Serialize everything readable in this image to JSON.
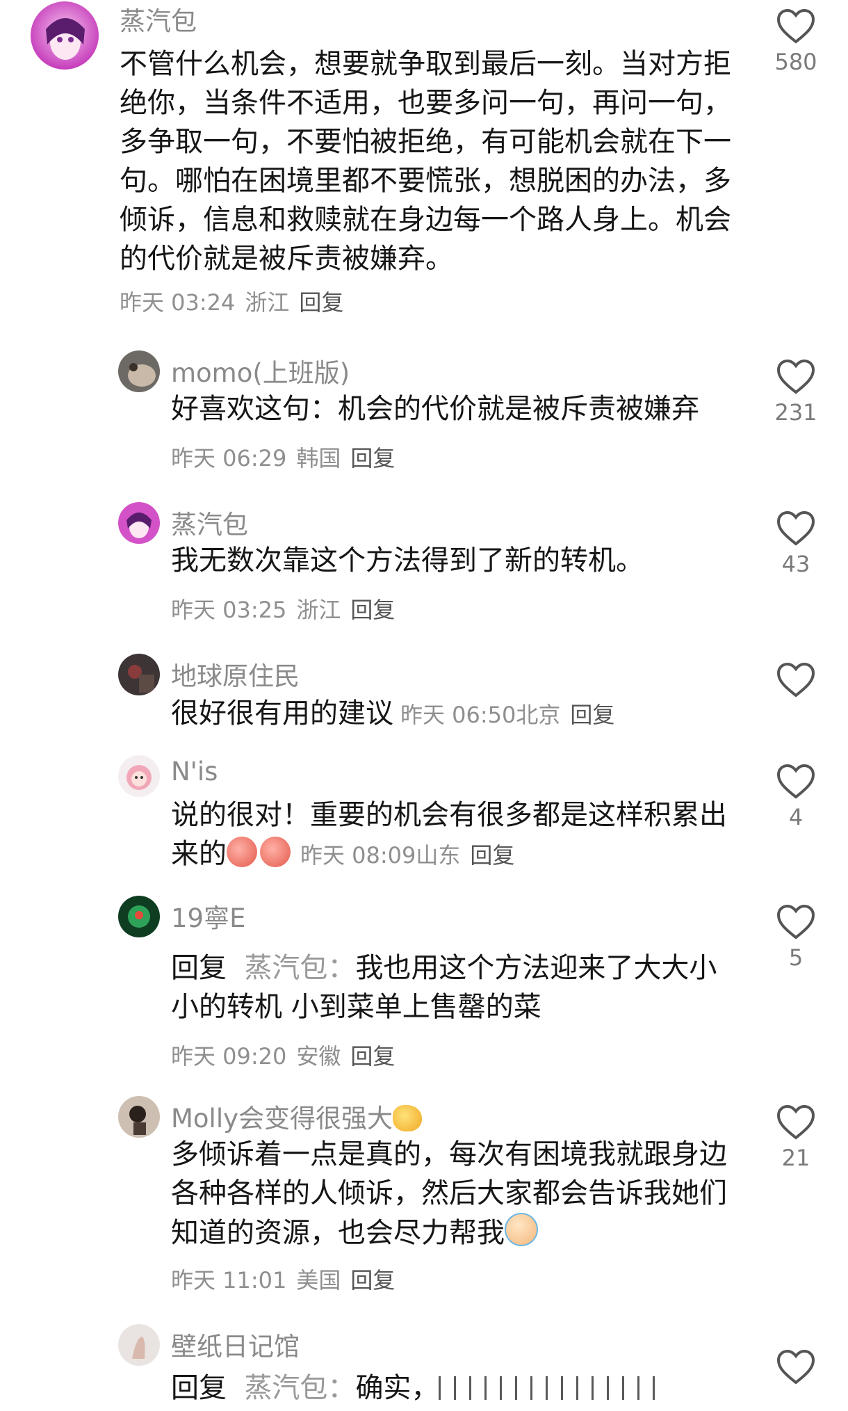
{
  "comments": [
    {
      "username": "蒸汽包",
      "text": "不管什么机会，想要就争取到最后一刻。当对方拒绝你，当条件不适用，也要多问一句，再问一句，多争取一句，不要怕被拒绝，有可能机会就在下一句。哪怕在困境里都不要慌张，想脱困的办法，多倾诉，信息和救赎就在身边每一个路人身上。机会的代价就是被斥责被嫌弃。",
      "time": "昨天 03:24",
      "location": "浙江",
      "reply_label": "回复",
      "likes": "580"
    }
  ],
  "replies": [
    {
      "username": "momo(上班版)",
      "text": "好喜欢这句：机会的代价就是被斥责被嫌弃",
      "time": "昨天 06:29",
      "location": "韩国",
      "reply_label": "回复",
      "likes": "231"
    },
    {
      "username": "蒸汽包",
      "text": "我无数次靠这个方法得到了新的转机。",
      "time": "昨天 03:25",
      "location": "浙江",
      "reply_label": "回复",
      "likes": "43"
    },
    {
      "username": "地球原住民",
      "text": "很好很有用的建议",
      "time": "昨天 06:50",
      "location": "北京",
      "reply_label": "回复",
      "likes": ""
    },
    {
      "username": "N'is",
      "text": "说的很对！重要的机会有很多都是这样积累出来的",
      "emoji": [
        "thumbs-up-icon",
        "thumbs-up-icon"
      ],
      "time": "昨天 08:09",
      "location": "山东",
      "reply_label": "回复",
      "likes": "4"
    },
    {
      "username": "19寧E",
      "reply_prefix": "回复",
      "reply_to": "蒸汽包：",
      "text": "我也用这个方法迎来了大大小小的转机 小到菜单上售罄的菜",
      "time": "昨天 09:20",
      "location": "安徽",
      "reply_label": "回复",
      "likes": "5"
    },
    {
      "username": "Molly会变得很强大",
      "username_emoji": "muscle-icon",
      "text": "多倾诉着一点是真的，每次有困境我就跟身边各种各样的人倾诉，然后大家都会告诉我她们知道的资源，也会尽力帮我",
      "emoji": [
        "crying-face-icon"
      ],
      "time": "昨天 11:01",
      "location": "美国",
      "reply_label": "回复",
      "likes": "21"
    },
    {
      "username": "壁纸日记馆",
      "reply_prefix": "回复",
      "reply_to": "蒸汽包：",
      "text": "确实，",
      "likes": ""
    }
  ],
  "colors": {
    "text": "#161616",
    "muted": "#8f8f8f",
    "reply_button": "#555555",
    "heart_stroke": "#555555"
  },
  "icons": {
    "like": "heart-outline-icon"
  }
}
